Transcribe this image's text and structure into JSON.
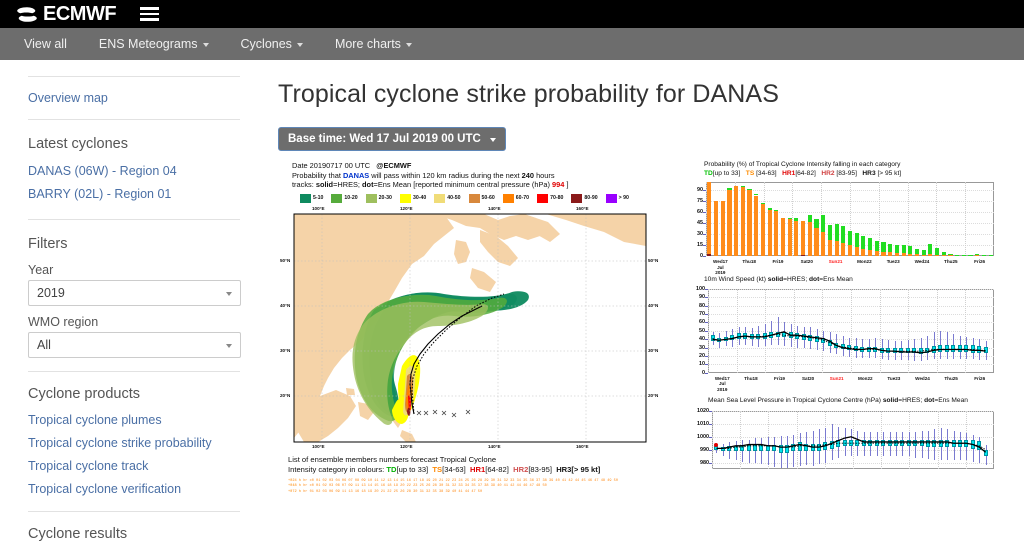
{
  "brand": {
    "name": "ECMWF",
    "logo_icon": "ecmwf-logo-icon",
    "menu_icon": "hamburger-icon"
  },
  "nav": {
    "items": [
      {
        "label": "View all",
        "has_caret": false
      },
      {
        "label": "ENS Meteograms",
        "has_caret": true
      },
      {
        "label": "Cyclones",
        "has_caret": true
      },
      {
        "label": "More charts",
        "has_caret": true
      }
    ]
  },
  "sidebar": {
    "overview_link": "Overview map",
    "latest_heading": "Latest cyclones",
    "latest_items": [
      "DANAS (06W) - Region 04",
      "BARRY (02L) - Region 01"
    ],
    "filters_heading": "Filters",
    "year_label": "Year",
    "year_value": "2019",
    "wmo_label": "WMO region",
    "wmo_value": "All",
    "products_heading": "Cyclone products",
    "products": [
      "Tropical cyclone plumes",
      "Tropical cyclone strike probability",
      "Tropical cyclone track",
      "Tropical cyclone verification"
    ],
    "results_heading": "Cyclone results"
  },
  "main": {
    "title": "Tropical cyclone strike probability for DANAS",
    "basetime_label": "Base time: Wed 17 Jul 2019 00 UTC"
  },
  "figure": {
    "header": {
      "line1_date": "Date 20190717 00 UTC",
      "line1_org": "@ECMWF",
      "line2_a": "Probability that",
      "line2_storm": "DANAS",
      "line2_b": "will pass within 120 km radius during the next",
      "line2_hours": "240",
      "line2_c": "hours",
      "line3_a": "tracks:",
      "line3_solid": "solid",
      "line3_b": "=HRES;",
      "line3_dot": "dot",
      "line3_c": "=Ens Mean [reported minimum central pressure (hPa)",
      "line3_pressure": "994",
      "line3_d": "]"
    },
    "legend": [
      {
        "label": "5-10",
        "color": "#0e8a5f"
      },
      {
        "label": "10-20",
        "color": "#56ab3c"
      },
      {
        "label": "20-30",
        "color": "#9ebf5e"
      },
      {
        "label": "30-40",
        "color": "#ffff00"
      },
      {
        "label": "40-50",
        "color": "#f0dc78"
      },
      {
        "label": "50-60",
        "color": "#d8883c"
      },
      {
        "label": "60-70",
        "color": "#ff8000"
      },
      {
        "label": "70-80",
        "color": "#ff0000"
      },
      {
        "label": "80-90",
        "color": "#8b1a1a"
      },
      {
        "label": "> 90",
        "color": "#9900ff"
      }
    ],
    "map": {
      "lon_ticks": [
        "100°E",
        "120°E",
        "140°E",
        "160°E"
      ],
      "lat_ticks": [
        "50°N",
        "40°N",
        "30°N",
        "20°N"
      ],
      "land_color": "#f5d3a8",
      "ocean_color": "#ffffff"
    },
    "ens_caption": {
      "line1": "List of ensemble members numbers forecast Tropical Cyclone",
      "line2_a": "Intensity category in colours:",
      "td": "TD",
      "td_range": "[up to 33]",
      "ts": "TS",
      "ts_range": "[34-63]",
      "hr1": "HR1",
      "hr1_range": "[64-82]",
      "hr2": "HR2",
      "hr2_range": "[83-95]",
      "hr3": "HR3",
      "hr3_range": "[> 95 kt]"
    },
    "ens_rows": [
      {
        "label": "+024 h",
        "text": "hr  c0 01 02 03 04     06 07 08 09 10 11 12 13 14 15 16 17 18 19 20 21 22 23 24 25 26     28 29 30 31 32 33 34 35 36 37 38 39 40 41 42     44 45 46 47 48 49 50"
      },
      {
        "label": "+048 h",
        "text": "hr  c0 01 02 03        06 07    09    11    13 14 15 16    18 19 20    22 23    25 26     28    30 31 32 33 34 35    37 38 39 40 41 42     44    46 47 48    50"
      },
      {
        "label": "+072 h",
        "text": "hr    01 02 03        06       09    11    13       16    18 19 20 21 22       25 26     28    30 31 32       35       38 39 40 41        44       47       50"
      }
    ]
  },
  "chart_data": [
    {
      "type": "bar",
      "title": "Probability (%) of Tropical Cyclone Intensity falling in each category",
      "legend": [
        {
          "name": "TD",
          "range": "[up to 33]",
          "color": "#00c000"
        },
        {
          "name": "TS",
          "range": "[34-63]",
          "color": "#ff8c00"
        },
        {
          "name": "HR1",
          "range": "[64-82]",
          "color": "#e00000"
        },
        {
          "name": "HR2",
          "range": "[83-95]",
          "color": "#d04040"
        },
        {
          "name": "HR3",
          "range": "[> 95 kt]",
          "color": "#111111"
        }
      ],
      "ylabel": "",
      "ylim": [
        0,
        100
      ],
      "yticks": [
        0,
        15,
        30,
        45,
        60,
        75,
        90
      ],
      "xticks": [
        "Wed17\nJul\n2019",
        "Thu18",
        "Fri19",
        "Sat20",
        "Sun21",
        "Mon22",
        "Tue23",
        "Wed24",
        "Thu25",
        "Fri26"
      ],
      "xtick_highlight": "Sun21",
      "grid": true,
      "stacked": true,
      "series": [
        {
          "name": "TS",
          "color": "#ff8c1a",
          "values": [
            97,
            75,
            75,
            90,
            95,
            93,
            90,
            82,
            70,
            63,
            61,
            52,
            50,
            48,
            46,
            46,
            38,
            33,
            22,
            20,
            18,
            15,
            12,
            10,
            8,
            7,
            6,
            5,
            4,
            4,
            3,
            3,
            2,
            3,
            2,
            1,
            1,
            1,
            1,
            1,
            1,
            1,
            1
          ]
        },
        {
          "name": "TD",
          "color": "#22dd22",
          "values": [
            0,
            0,
            0,
            2,
            0,
            2,
            1,
            2,
            2,
            2,
            2,
            0,
            2,
            3,
            0,
            10,
            12,
            22,
            20,
            24,
            23,
            19,
            20,
            17,
            16,
            13,
            13,
            12,
            11,
            11,
            11,
            7,
            7,
            13,
            9,
            5,
            2,
            1,
            1,
            1,
            2,
            1,
            1
          ]
        },
        {
          "name": "HR2",
          "color": "#8b1a1a",
          "values": [
            3,
            0,
            0,
            0,
            0,
            0,
            0,
            0,
            0,
            0,
            0,
            0,
            0,
            0,
            2,
            0,
            0,
            0,
            0,
            0,
            0,
            0,
            0,
            0,
            0,
            0,
            0,
            0,
            0,
            0,
            0,
            0,
            0,
            0,
            0,
            0,
            0,
            0,
            0,
            0,
            0,
            0,
            0
          ]
        }
      ]
    },
    {
      "type": "boxplot",
      "title_a": "10m Wind Speed (kt)",
      "title_solid": "solid",
      "title_b": "=HRES;",
      "title_dot": "dot",
      "title_c": "=Ens Mean",
      "ylim": [
        0,
        100
      ],
      "yticks": [
        0,
        10,
        20,
        30,
        40,
        50,
        60,
        70,
        80,
        90,
        100
      ],
      "xticks": [
        "Wed17\nJul\n2019",
        "Thu18",
        "Fri19",
        "Sat20",
        "Sun21",
        "Mon22",
        "Tue23",
        "Wed24",
        "Thu25",
        "Fri26"
      ],
      "xtick_highlight": "Sun21",
      "box_color": "#00e5ee",
      "whisker_color": "#7a7ad0",
      "hres_line": [
        40,
        39,
        40,
        41,
        43,
        44,
        43,
        43,
        43,
        45,
        47,
        49,
        45,
        45,
        44,
        43,
        42,
        41,
        38,
        33,
        30,
        29,
        28,
        28,
        29,
        29,
        27,
        26,
        26,
        25,
        25,
        25,
        24,
        25,
        27,
        28,
        28,
        28,
        28,
        28,
        27,
        27,
        26
      ],
      "ens_mean": [
        41,
        39,
        40,
        41,
        43,
        43,
        43,
        43,
        44,
        45,
        46,
        45,
        44,
        44,
        43,
        42,
        41,
        39,
        36,
        33,
        31,
        30,
        29,
        28,
        28,
        28,
        27,
        26,
        26,
        26,
        26,
        26,
        26,
        27,
        28,
        28,
        28,
        28,
        28,
        28,
        28,
        27,
        27
      ],
      "boxes": [
        {
          "q1": 38,
          "q3": 45,
          "lo": 33,
          "hi": 48
        },
        {
          "q1": 37,
          "q3": 42,
          "lo": 30,
          "hi": 47
        },
        {
          "q1": 38,
          "q3": 43,
          "lo": 32,
          "hi": 50
        },
        {
          "q1": 39,
          "q3": 45,
          "lo": 31,
          "hi": 52
        },
        {
          "q1": 40,
          "q3": 47,
          "lo": 33,
          "hi": 55
        },
        {
          "q1": 40,
          "q3": 47,
          "lo": 33,
          "hi": 54
        },
        {
          "q1": 40,
          "q3": 46,
          "lo": 32,
          "hi": 53
        },
        {
          "q1": 40,
          "q3": 46,
          "lo": 31,
          "hi": 56
        },
        {
          "q1": 40,
          "q3": 47,
          "lo": 32,
          "hi": 58
        },
        {
          "q1": 41,
          "q3": 48,
          "lo": 33,
          "hi": 62
        },
        {
          "q1": 42,
          "q3": 49,
          "lo": 33,
          "hi": 66
        },
        {
          "q1": 42,
          "q3": 49,
          "lo": 32,
          "hi": 60
        },
        {
          "q1": 41,
          "q3": 48,
          "lo": 31,
          "hi": 58
        },
        {
          "q1": 40,
          "q3": 47,
          "lo": 30,
          "hi": 56
        },
        {
          "q1": 39,
          "q3": 46,
          "lo": 29,
          "hi": 55
        },
        {
          "q1": 38,
          "q3": 45,
          "lo": 28,
          "hi": 54
        },
        {
          "q1": 37,
          "q3": 44,
          "lo": 27,
          "hi": 52
        },
        {
          "q1": 35,
          "q3": 42,
          "lo": 26,
          "hi": 50
        },
        {
          "q1": 32,
          "q3": 39,
          "lo": 24,
          "hi": 48
        },
        {
          "q1": 29,
          "q3": 36,
          "lo": 22,
          "hi": 46
        },
        {
          "q1": 28,
          "q3": 34,
          "lo": 20,
          "hi": 44
        },
        {
          "q1": 27,
          "q3": 33,
          "lo": 19,
          "hi": 42
        },
        {
          "q1": 26,
          "q3": 32,
          "lo": 18,
          "hi": 41
        },
        {
          "q1": 25,
          "q3": 31,
          "lo": 18,
          "hi": 40
        },
        {
          "q1": 25,
          "q3": 31,
          "lo": 17,
          "hi": 40
        },
        {
          "q1": 25,
          "q3": 31,
          "lo": 17,
          "hi": 41
        },
        {
          "q1": 24,
          "q3": 30,
          "lo": 16,
          "hi": 40
        },
        {
          "q1": 23,
          "q3": 29,
          "lo": 15,
          "hi": 39
        },
        {
          "q1": 23,
          "q3": 29,
          "lo": 15,
          "hi": 38
        },
        {
          "q1": 23,
          "q3": 29,
          "lo": 15,
          "hi": 38
        },
        {
          "q1": 23,
          "q3": 29,
          "lo": 15,
          "hi": 39
        },
        {
          "q1": 23,
          "q3": 29,
          "lo": 14,
          "hi": 40
        },
        {
          "q1": 22,
          "q3": 29,
          "lo": 14,
          "hi": 42
        },
        {
          "q1": 23,
          "q3": 30,
          "lo": 15,
          "hi": 44
        },
        {
          "q1": 24,
          "q3": 32,
          "lo": 16,
          "hi": 48
        },
        {
          "q1": 25,
          "q3": 33,
          "lo": 16,
          "hi": 50
        },
        {
          "q1": 25,
          "q3": 33,
          "lo": 16,
          "hi": 48
        },
        {
          "q1": 25,
          "q3": 33,
          "lo": 16,
          "hi": 46
        },
        {
          "q1": 25,
          "q3": 33,
          "lo": 16,
          "hi": 44
        },
        {
          "q1": 25,
          "q3": 33,
          "lo": 16,
          "hi": 43
        },
        {
          "q1": 24,
          "q3": 33,
          "lo": 16,
          "hi": 42
        },
        {
          "q1": 24,
          "q3": 32,
          "lo": 15,
          "hi": 40
        },
        {
          "q1": 23,
          "q3": 31,
          "lo": 15,
          "hi": 38
        }
      ]
    },
    {
      "type": "boxplot",
      "title_a": "Mean Sea Level Pressure in Tropical Cyclone Centre (hPa)",
      "title_solid": "solid",
      "title_b": "=HRES;",
      "title_dot": "dot",
      "title_c": "=Ens Mean",
      "ylim": [
        975,
        1020
      ],
      "yticks": [
        980,
        990,
        1000,
        1010,
        1020
      ],
      "box_color": "#00e5ee",
      "whisker_color": "#7a7ad0",
      "start_marker": {
        "value": 994,
        "color": "#e00000"
      },
      "hres_line": [
        991,
        991,
        992,
        993,
        993,
        994,
        994,
        994,
        993,
        993,
        992,
        992,
        993,
        994,
        993,
        992,
        992,
        993,
        995,
        997,
        999,
        1000,
        998,
        996,
        996,
        996,
        996,
        996,
        996,
        996,
        996,
        996,
        996,
        996,
        996,
        996,
        996,
        995,
        995,
        995,
        994,
        992,
        988
      ],
      "ens_mean": [
        991,
        991,
        991,
        992,
        992,
        993,
        993,
        993,
        993,
        993,
        992,
        992,
        992,
        993,
        993,
        993,
        993,
        994,
        994,
        995,
        995,
        995,
        995,
        995,
        995,
        995,
        995,
        995,
        995,
        995,
        995,
        995,
        995,
        995,
        995,
        995,
        995,
        995,
        995,
        995,
        994,
        993,
        990
      ],
      "boxes": [
        {
          "q1": 990,
          "q3": 993,
          "lo": 988,
          "hi": 995
        },
        {
          "q1": 989,
          "q3": 992,
          "lo": 985,
          "hi": 995
        },
        {
          "q1": 989,
          "q3": 993,
          "lo": 983,
          "hi": 996
        },
        {
          "q1": 989,
          "q3": 993,
          "lo": 982,
          "hi": 997
        },
        {
          "q1": 989,
          "q3": 994,
          "lo": 981,
          "hi": 998
        },
        {
          "q1": 989,
          "q3": 994,
          "lo": 980,
          "hi": 998
        },
        {
          "q1": 989,
          "q3": 994,
          "lo": 980,
          "hi": 999
        },
        {
          "q1": 989,
          "q3": 994,
          "lo": 979,
          "hi": 999
        },
        {
          "q1": 989,
          "q3": 994,
          "lo": 978,
          "hi": 1000
        },
        {
          "q1": 989,
          "q3": 994,
          "lo": 977,
          "hi": 1000
        },
        {
          "q1": 988,
          "q3": 994,
          "lo": 976,
          "hi": 1001
        },
        {
          "q1": 988,
          "q3": 994,
          "lo": 976,
          "hi": 1001
        },
        {
          "q1": 989,
          "q3": 995,
          "lo": 977,
          "hi": 1002
        },
        {
          "q1": 989,
          "q3": 996,
          "lo": 978,
          "hi": 1003
        },
        {
          "q1": 989,
          "q3": 995,
          "lo": 978,
          "hi": 1004
        },
        {
          "q1": 989,
          "q3": 995,
          "lo": 978,
          "hi": 1005
        },
        {
          "q1": 989,
          "q3": 995,
          "lo": 979,
          "hi": 1006
        },
        {
          "q1": 990,
          "q3": 996,
          "lo": 980,
          "hi": 1007
        },
        {
          "q1": 991,
          "q3": 997,
          "lo": 982,
          "hi": 1010
        },
        {
          "q1": 992,
          "q3": 998,
          "lo": 984,
          "hi": 1008
        },
        {
          "q1": 993,
          "q3": 998,
          "lo": 985,
          "hi": 1007
        },
        {
          "q1": 993,
          "q3": 998,
          "lo": 985,
          "hi": 1006
        },
        {
          "q1": 993,
          "q3": 998,
          "lo": 985,
          "hi": 1005
        },
        {
          "q1": 993,
          "q3": 998,
          "lo": 985,
          "hi": 1004
        },
        {
          "q1": 993,
          "q3": 998,
          "lo": 985,
          "hi": 1004
        },
        {
          "q1": 993,
          "q3": 998,
          "lo": 985,
          "hi": 1004
        },
        {
          "q1": 993,
          "q3": 998,
          "lo": 985,
          "hi": 1004
        },
        {
          "q1": 993,
          "q3": 998,
          "lo": 985,
          "hi": 1004
        },
        {
          "q1": 993,
          "q3": 998,
          "lo": 985,
          "hi": 1004
        },
        {
          "q1": 993,
          "q3": 998,
          "lo": 985,
          "hi": 1004
        },
        {
          "q1": 993,
          "q3": 998,
          "lo": 985,
          "hi": 1004
        },
        {
          "q1": 993,
          "q3": 998,
          "lo": 984,
          "hi": 1004
        },
        {
          "q1": 993,
          "q3": 998,
          "lo": 984,
          "hi": 1005
        },
        {
          "q1": 992,
          "q3": 998,
          "lo": 983,
          "hi": 1005
        },
        {
          "q1": 992,
          "q3": 998,
          "lo": 982,
          "hi": 1006
        },
        {
          "q1": 992,
          "q3": 998,
          "lo": 982,
          "hi": 1007
        },
        {
          "q1": 992,
          "q3": 998,
          "lo": 982,
          "hi": 1006
        },
        {
          "q1": 992,
          "q3": 998,
          "lo": 982,
          "hi": 1005
        },
        {
          "q1": 992,
          "q3": 998,
          "lo": 982,
          "hi": 1004
        },
        {
          "q1": 992,
          "q3": 998,
          "lo": 982,
          "hi": 1003
        },
        {
          "q1": 991,
          "q3": 998,
          "lo": 981,
          "hi": 1002
        },
        {
          "q1": 990,
          "q3": 997,
          "lo": 980,
          "hi": 1000
        },
        {
          "q1": 985,
          "q3": 990,
          "lo": 978,
          "hi": 994
        }
      ]
    }
  ]
}
